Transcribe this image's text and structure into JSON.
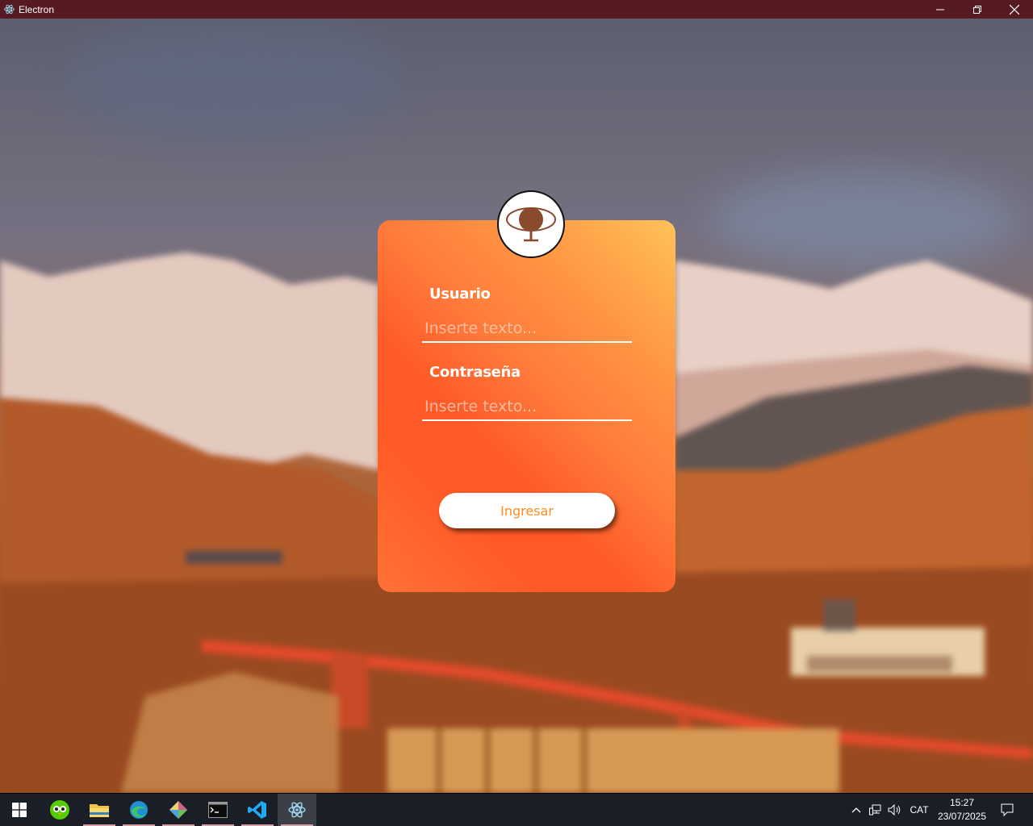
{
  "window": {
    "title": "Electron",
    "app_icon": "electron-icon",
    "controls": [
      "minimize-icon",
      "restore-icon",
      "close-icon"
    ],
    "titlebar_color": "#561b22"
  },
  "login": {
    "logo_icon": "eye-globe-icon",
    "username_label": "Usuario",
    "username_placeholder": "Inserte texto...",
    "username_value": "",
    "password_label": "Contraseña",
    "password_placeholder": "Inserte texto...",
    "password_value": "",
    "submit_label": "Ingresar",
    "accent_color": "#ff8a1e"
  },
  "taskbar": {
    "apps": [
      {
        "name": "start-button",
        "icon": "windows-logo-icon"
      },
      {
        "name": "duolingo-app",
        "icon": "owl-icon"
      },
      {
        "name": "file-explorer-app",
        "icon": "folder-icon"
      },
      {
        "name": "edge-app",
        "icon": "edge-icon"
      },
      {
        "name": "git-app",
        "icon": "git-diamond-icon"
      },
      {
        "name": "terminal-app",
        "icon": "terminal-icon"
      },
      {
        "name": "vscode-app",
        "icon": "vscode-icon"
      },
      {
        "name": "electron-app",
        "icon": "electron-icon"
      }
    ],
    "tray": {
      "language": "CAT",
      "time": "15:27",
      "date": "23/07/2025"
    }
  }
}
